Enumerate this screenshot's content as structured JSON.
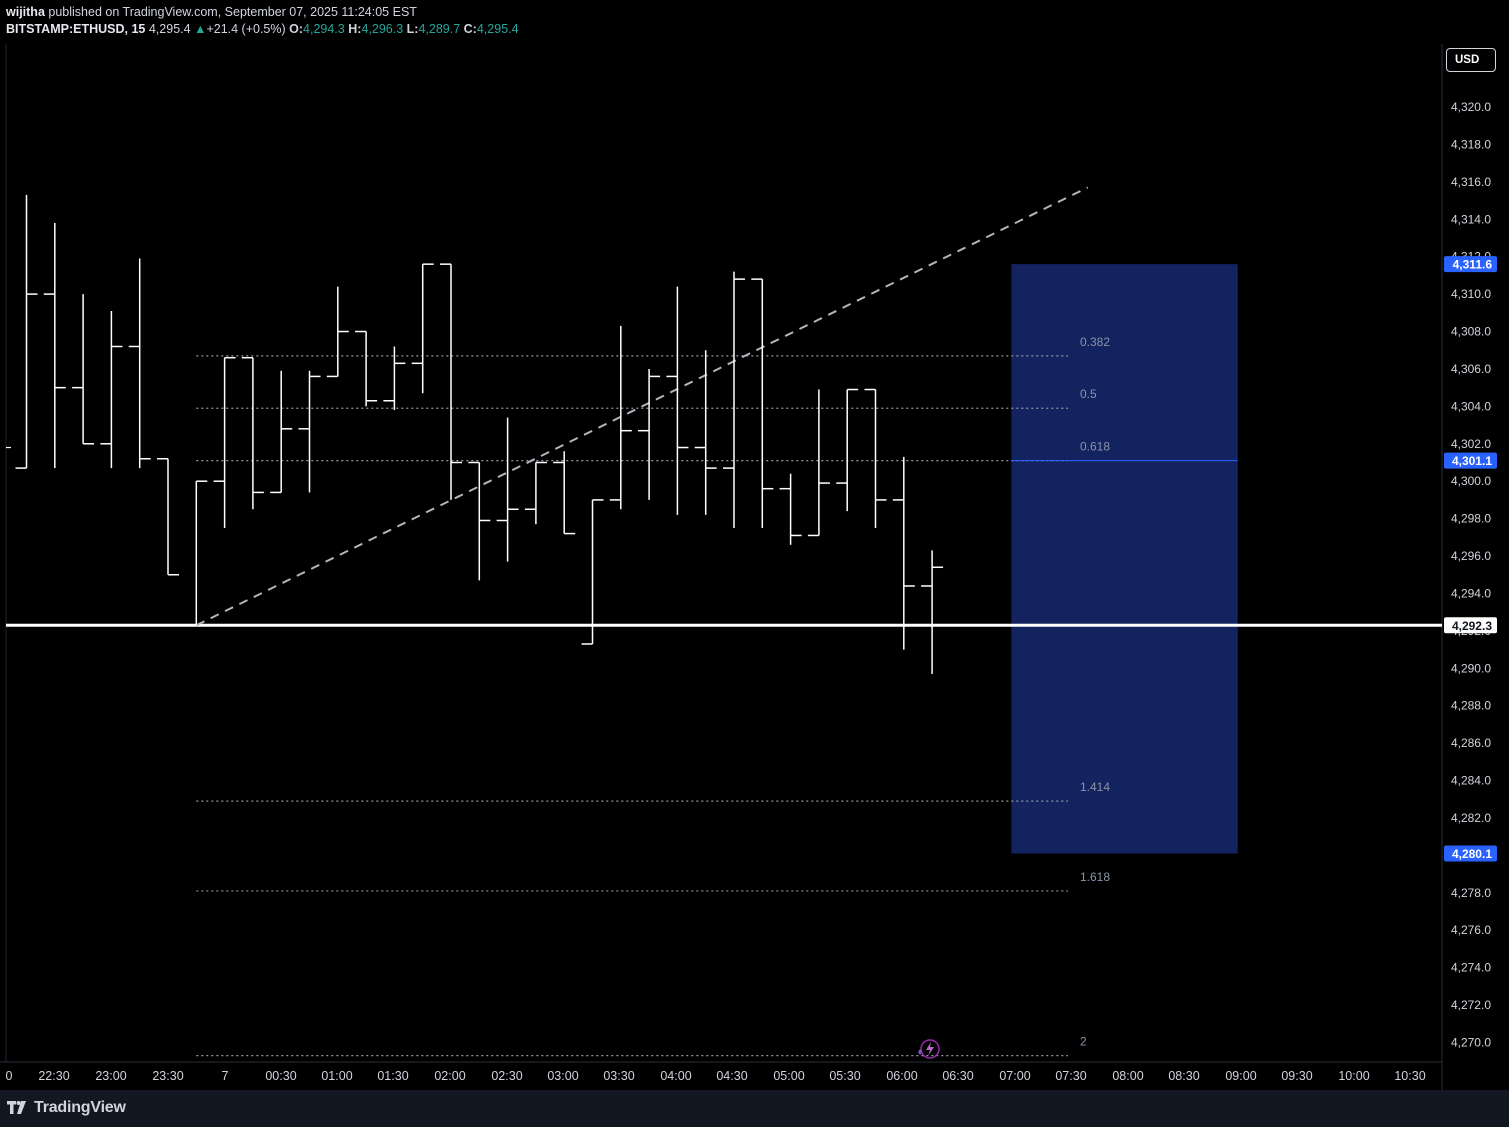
{
  "header": {
    "author": "wijitha",
    "published_text": "published on TradingView.com, September 07, 2025 11:24:05 EST",
    "symbol": "BITSTAMP:ETHUSD, 15",
    "last_price": "4,295.4",
    "change": "+21.4 (+0.5%)",
    "open_label": "O:",
    "open": "4,294.3",
    "high_label": "H:",
    "high": "4,296.3",
    "low_label": "L:",
    "low": "4,289.7",
    "close_label": "C:",
    "close": "4,295.4"
  },
  "currency_button": "USD",
  "footer": {
    "brand": "TradingView"
  },
  "colors": {
    "background": "#000000",
    "bars": "#ffffff",
    "up": "#26a69a",
    "fib_box": "#13235f",
    "price_badge": "#2962ff",
    "axis_text": "#d1d4dc"
  },
  "chart_data": {
    "type": "ohlc",
    "y_axis": {
      "min": 4269,
      "max": 4323,
      "ticks": [
        "4,270.0",
        "4,272.0",
        "4,274.0",
        "4,276.0",
        "4,278.0",
        "4,280.0",
        "4,282.0",
        "4,284.0",
        "4,286.0",
        "4,288.0",
        "4,290.0",
        "4,292.0",
        "4,294.0",
        "4,296.0",
        "4,298.0",
        "4,300.0",
        "4,302.0",
        "4,304.0",
        "4,306.0",
        "4,308.0",
        "4,310.0",
        "4,312.0",
        "4,314.0",
        "4,316.0",
        "4,318.0",
        "4,320.0"
      ],
      "tick_values": [
        4270,
        4272,
        4274,
        4276,
        4278,
        4280,
        4282,
        4284,
        4286,
        4288,
        4290,
        4292,
        4294,
        4296,
        4298,
        4300,
        4302,
        4304,
        4306,
        4308,
        4310,
        4312,
        4314,
        4316,
        4318,
        4320
      ]
    },
    "x_axis": {
      "labels": [
        "0",
        "22:30",
        "23:00",
        "23:30",
        "7",
        "00:30",
        "01:00",
        "01:30",
        "02:00",
        "02:30",
        "03:00",
        "03:30",
        "04:00",
        "04:30",
        "05:00",
        "05:30",
        "06:00",
        "06:30",
        "07:00",
        "07:30",
        "08:00",
        "08:30",
        "09:00",
        "09:30",
        "10:00",
        "10:30"
      ]
    },
    "bars": [
      {
        "o": 4300.7,
        "h": 4315.3,
        "l": 4300.7,
        "c": 4310.0
      },
      {
        "o": 4310.0,
        "h": 4313.8,
        "l": 4300.7,
        "c": 4305.0
      },
      {
        "o": 4305.0,
        "h": 4310.0,
        "l": 4302.0,
        "c": 4302.0
      },
      {
        "o": 4302.0,
        "h": 4309.1,
        "l": 4300.7,
        "c": 4307.2
      },
      {
        "o": 4307.2,
        "h": 4311.9,
        "l": 4300.7,
        "c": 4301.2
      },
      {
        "o": 4301.2,
        "h": 4301.2,
        "l": 4295.0,
        "c": 4295.0
      },
      {
        "o": 4292.3,
        "h": 4300.0,
        "l": 4292.3,
        "c": 4300.0
      },
      {
        "o": 4300.0,
        "h": 4306.6,
        "l": 4297.5,
        "c": 4306.6
      },
      {
        "o": 4306.6,
        "h": 4306.6,
        "l": 4298.5,
        "c": 4299.4
      },
      {
        "o": 4299.4,
        "h": 4305.9,
        "l": 4299.8,
        "c": 4302.8
      },
      {
        "o": 4302.8,
        "h": 4305.9,
        "l": 4299.4,
        "c": 4305.6
      },
      {
        "o": 4305.6,
        "h": 4310.4,
        "l": 4305.6,
        "c": 4308.0
      },
      {
        "o": 4308.0,
        "h": 4307.6,
        "l": 4304.0,
        "c": 4304.3
      },
      {
        "o": 4304.3,
        "h": 4307.2,
        "l": 4303.8,
        "c": 4306.3
      },
      {
        "o": 4306.3,
        "h": 4311.6,
        "l": 4304.7,
        "c": 4311.6
      },
      {
        "o": 4311.6,
        "h": 4311.6,
        "l": 4299.0,
        "c": 4301.0
      },
      {
        "o": 4301.0,
        "h": 4299.8,
        "l": 4294.7,
        "c": 4297.9
      },
      {
        "o": 4297.9,
        "h": 4303.4,
        "l": 4295.7,
        "c": 4298.5
      },
      {
        "o": 4298.5,
        "h": 4301.0,
        "l": 4297.7,
        "c": 4301.0
      },
      {
        "o": 4301.0,
        "h": 4301.6,
        "l": 4297.2,
        "c": 4297.2
      },
      {
        "o": 4291.3,
        "h": 4299.0,
        "l": 4291.3,
        "c": 4299.0
      },
      {
        "o": 4299.0,
        "h": 4308.3,
        "l": 4298.5,
        "c": 4302.7
      },
      {
        "o": 4302.7,
        "h": 4306.0,
        "l": 4299.0,
        "c": 4305.6
      },
      {
        "o": 4305.6,
        "h": 4310.4,
        "l": 4298.2,
        "c": 4301.8
      },
      {
        "o": 4301.8,
        "h": 4307.0,
        "l": 4298.2,
        "c": 4300.7
      },
      {
        "o": 4300.7,
        "h": 4311.2,
        "l": 4297.5,
        "c": 4310.8
      },
      {
        "o": 4310.8,
        "h": 4310.8,
        "l": 4297.5,
        "c": 4299.6
      },
      {
        "o": 4299.6,
        "h": 4300.4,
        "l": 4296.6,
        "c": 4297.1
      },
      {
        "o": 4297.1,
        "h": 4304.9,
        "l": 4297.2,
        "c": 4299.9
      },
      {
        "o": 4299.9,
        "h": 4304.9,
        "l": 4298.4,
        "c": 4304.9
      },
      {
        "o": 4304.9,
        "h": 4304.9,
        "l": 4297.5,
        "c": 4299.0
      },
      {
        "o": 4299.0,
        "h": 4301.3,
        "l": 4291.0,
        "c": 4294.4
      },
      {
        "o": 4294.4,
        "h": 4296.3,
        "l": 4289.7,
        "c": 4295.4
      }
    ],
    "horizontal_line": {
      "value": 4292.3,
      "label": "4,292.3"
    },
    "trend_line": {
      "from": {
        "bar": 6,
        "value": 4292.3
      },
      "to": {
        "bar": 37.5,
        "value": 4315.7
      },
      "style": "dashed"
    },
    "fib_levels": [
      {
        "label": "0.382",
        "value": 4306.7
      },
      {
        "label": "0.5",
        "value": 4303.9
      },
      {
        "label": "0.618",
        "value": 4301.1
      },
      {
        "label": "1.414",
        "value": 4282.9
      },
      {
        "label": "1.618",
        "value": 4278.1
      },
      {
        "label": "2",
        "value": 4269.3
      }
    ],
    "fib_box": {
      "top": 4311.6,
      "bottom": 4280.1,
      "start_bar": 34.8,
      "end_bar": 42.8
    },
    "price_badges": [
      {
        "value": 4311.6,
        "label": "4,311.6",
        "style": "blue"
      },
      {
        "value": 4301.1,
        "label": "4,301.1",
        "style": "blue"
      },
      {
        "value": 4292.3,
        "label": "4,292.3",
        "style": "white"
      },
      {
        "value": 4280.1,
        "label": "4,280.1",
        "style": "blue"
      }
    ]
  }
}
